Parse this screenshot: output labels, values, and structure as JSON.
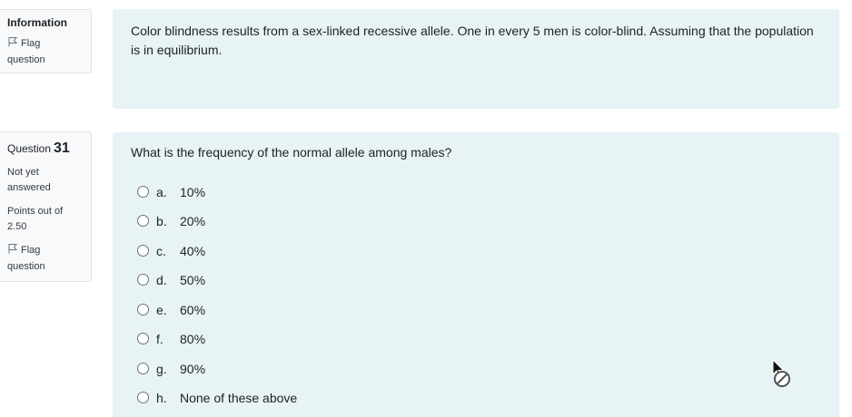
{
  "info": {
    "title": "Information",
    "flag_line1": "Flag",
    "flag_line2": "question",
    "text": "Color blindness results from a sex-linked recessive allele. One in every 5 men is color-blind.  Assuming that the population is in equilibrium."
  },
  "question": {
    "label": "Question",
    "number": "31",
    "state_line1": "Not yet",
    "state_line2": "answered",
    "grade_line1": "Points out of",
    "grade_line2": "2.50",
    "flag_line1": "Flag",
    "flag_line2": "question",
    "text": "What is the frequency of the normal allele among males?",
    "answers": [
      {
        "letter": "a.",
        "text": "10%"
      },
      {
        "letter": "b.",
        "text": "20%"
      },
      {
        "letter": "c.",
        "text": "40%"
      },
      {
        "letter": "d.",
        "text": "50%"
      },
      {
        "letter": "e.",
        "text": "60%"
      },
      {
        "letter": "f.",
        "text": "80%"
      },
      {
        "letter": "g.",
        "text": "90%"
      },
      {
        "letter": "h.",
        "text": "None of these above"
      }
    ]
  },
  "colors": {
    "content_bg": "#e7f3f5",
    "sidebar_bg": "#f8f9fa",
    "border": "#dee2e6"
  },
  "icons": {
    "flag": "flag-outline-icon",
    "cursor": "not-allowed-cursor-icon"
  }
}
